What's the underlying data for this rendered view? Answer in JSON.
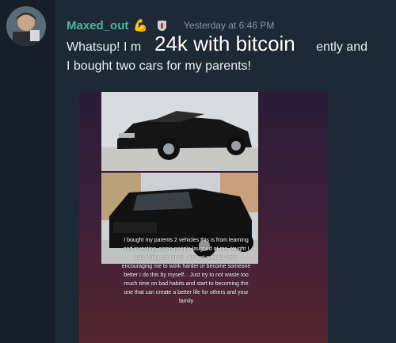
{
  "message": {
    "username": "Maxed_out",
    "username_emoji": "💪",
    "timestamp": "Yesterday at 6:46 PM",
    "text_line1": "Whatsup! I m",
    "text_line1_end": "ently and",
    "text_line2": "I bought two cars for my parents!",
    "overlay_text": "24k with bitcoin",
    "story_caption": "I bought my parents 2 vehicles this is from learning and investing, some people laughed at me, tought I was doing too much , almost nobody were encouraging me to work harder or become someone better I do this by myself... Just try to not waste too much time on bad habits and start to becoming the one that can create a better life for others and your family"
  },
  "colors": {
    "username": "#4fb6a0",
    "background": "#1d2a36",
    "text": "#e9eef2",
    "timestamp": "#8a97a4"
  },
  "icons": {
    "avatar": "user-avatar",
    "badge": "shield-icon"
  }
}
